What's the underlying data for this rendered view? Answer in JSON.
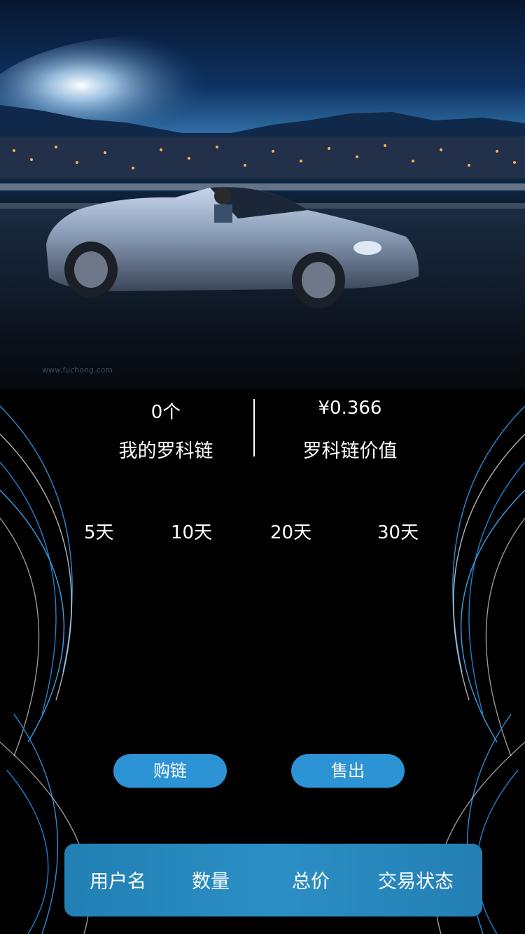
{
  "hero": {
    "watermark": "www.fuchong.com"
  },
  "stats": [
    {
      "value": "0个",
      "label": "我的罗科链"
    },
    {
      "value": "¥0.366",
      "label": "罗科链价值"
    }
  ],
  "periods": [
    "5天",
    "10天",
    "20天",
    "30天"
  ],
  "actions": {
    "buy": "购链",
    "sell": "售出"
  },
  "table": {
    "headers": [
      "用户名",
      "数量",
      "总价",
      "交易状态"
    ]
  },
  "colors": {
    "accent": "#2c93d4",
    "table_header": "#2a8bc0",
    "background": "#000000"
  }
}
